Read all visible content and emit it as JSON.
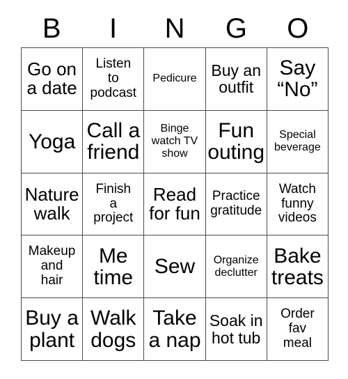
{
  "card": {
    "title": "BINGO",
    "columns": 5,
    "rows": 5,
    "header_letters": [
      "B",
      "I",
      "N",
      "G",
      "O"
    ],
    "colors": {
      "background": "#ffffff",
      "text": "#000000",
      "grid_line": "#4a4a4a"
    },
    "cells": [
      {
        "text": "Go on\na date",
        "size": "xl"
      },
      {
        "text": "Listen\nto\npodcast",
        "size": "md"
      },
      {
        "text": "Pedicure",
        "size": "sm"
      },
      {
        "text": "Buy an\noutfit",
        "size": "lg"
      },
      {
        "text": "Say\n“No”",
        "size": "xxl"
      },
      {
        "text": "Yoga",
        "size": "xxl"
      },
      {
        "text": "Call a\nfriend",
        "size": "xxl"
      },
      {
        "text": "Binge\nwatch TV\nshow",
        "size": "sm"
      },
      {
        "text": "Fun\nouting",
        "size": "xxl"
      },
      {
        "text": "Special\nbeverage",
        "size": "sm"
      },
      {
        "text": "Nature\nwalk",
        "size": "xl"
      },
      {
        "text": "Finish\na\nproject",
        "size": "md"
      },
      {
        "text": "Read\nfor fun",
        "size": "xl"
      },
      {
        "text": "Practice\ngratitude",
        "size": "md"
      },
      {
        "text": "Watch\nfunny\nvideos",
        "size": "md"
      },
      {
        "text": "Makeup\nand\nhair",
        "size": "md"
      },
      {
        "text": "Me\ntime",
        "size": "xxl"
      },
      {
        "text": "Sew",
        "size": "xxl"
      },
      {
        "text": "Organize\ndeclutter",
        "size": "sm"
      },
      {
        "text": "Bake\ntreats",
        "size": "xxl"
      },
      {
        "text": "Buy a\nplant",
        "size": "xxl"
      },
      {
        "text": "Walk\ndogs",
        "size": "xxl"
      },
      {
        "text": "Take\na nap",
        "size": "xxl"
      },
      {
        "text": "Soak in\nhot tub",
        "size": "lg"
      },
      {
        "text": "Order\nfav\nmeal",
        "size": "md"
      }
    ]
  }
}
